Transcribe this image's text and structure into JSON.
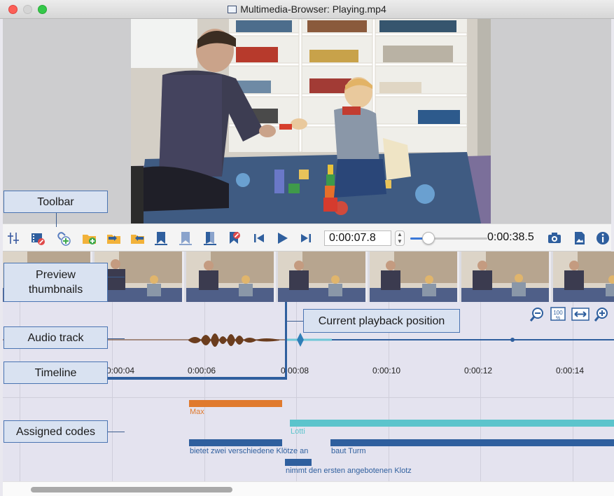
{
  "window": {
    "title": "Multimedia-Browser:  Playing.mp4"
  },
  "toolbar": {
    "current_time": "0:00:07.8",
    "duration": "0:00:38.5",
    "volume_level": 0.2,
    "buttons": [
      "sliders-icon",
      "film-edit-icon",
      "link-add-icon",
      "folder-add-icon",
      "folder-previous-icon",
      "folder-next-icon",
      "bookmark-icon",
      "bookmark-outline-icon",
      "bookmark-split-icon",
      "bookmark-delete-icon",
      "skip-back-icon",
      "play-icon",
      "skip-forward-icon",
      "camera-icon",
      "image-export-icon",
      "info-icon"
    ]
  },
  "timeline": {
    "ticks": [
      "0:00:04",
      "0:00:06",
      "0:00:08",
      "0:00:10",
      "0:00:12",
      "0:00:14"
    ],
    "zoom_buttons": [
      "zoom-out-icon",
      "zoom-100-icon",
      "fit-width-icon",
      "zoom-in-icon"
    ]
  },
  "codes": {
    "max": "Max",
    "lotti": "Lotti",
    "code1": "bietet zwei verschiedene Klötze an",
    "code2": "baut Turm",
    "code3": "nimmt den ersten angebotenen Klotz"
  },
  "callouts": {
    "toolbar": "Toolbar",
    "preview": "Preview\nthumbnails",
    "audio": "Audio track",
    "timeline": "Timeline",
    "codes": "Assigned codes",
    "playback": "Current playback position"
  },
  "colors": {
    "accent_blue": "#2f5f9e",
    "max_orange": "#e07a2e",
    "lotti_teal": "#5cc4cc",
    "audio_brown": "#6b3d1e",
    "callout_fill": "#d9e2f1"
  }
}
